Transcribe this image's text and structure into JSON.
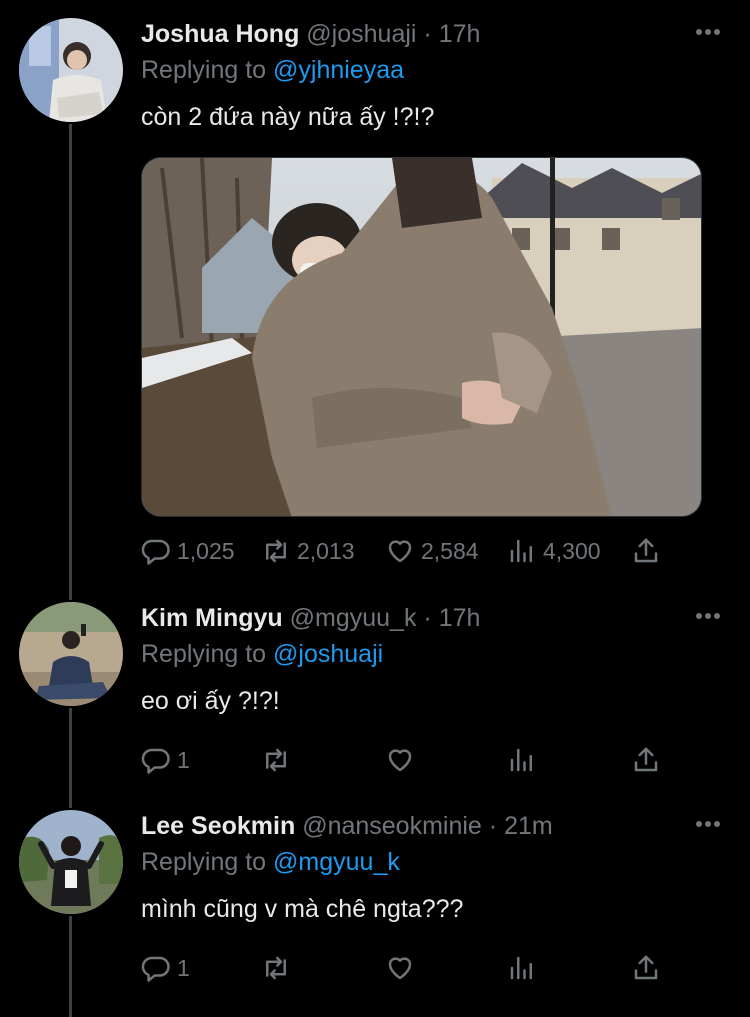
{
  "tweets": [
    {
      "name": "Joshua Hong",
      "handle": "@joshuaji",
      "dot": "·",
      "time": "17h",
      "replying_prefix": "Replying to",
      "replying_to": "@yjhnieyaa",
      "text": "còn 2 đứa này nữa ấy !?!?",
      "has_media": true,
      "reply_count": "1,025",
      "retweet_count": "2,013",
      "like_count": "2,584",
      "view_count": "4,300"
    },
    {
      "name": "Kim Mingyu",
      "handle": "@mgyuu_k",
      "dot": "·",
      "time": "17h",
      "replying_prefix": "Replying to",
      "replying_to": "@joshuaji",
      "text": "eo ơi ấy ?!?!",
      "has_media": false,
      "reply_count": "1",
      "retweet_count": "",
      "like_count": "",
      "view_count": ""
    },
    {
      "name": "Lee Seokmin",
      "handle": "@nanseokminie",
      "dot": "·",
      "time": "21m",
      "replying_prefix": "Replying to",
      "replying_to": "@mgyuu_k",
      "text": "mình cũng v mà chê ngta???",
      "has_media": false,
      "reply_count": "1",
      "retweet_count": "",
      "like_count": "",
      "view_count": ""
    }
  ],
  "icons": {
    "reply": "reply-icon",
    "retweet": "retweet-icon",
    "like": "heart-icon",
    "views": "views-icon",
    "share": "share-icon",
    "more": "more-icon"
  },
  "colors": {
    "background": "#000000",
    "text": "#e7e9ea",
    "muted": "#71767b",
    "accent": "#1d9bf0",
    "thread_line": "#3e4144"
  }
}
